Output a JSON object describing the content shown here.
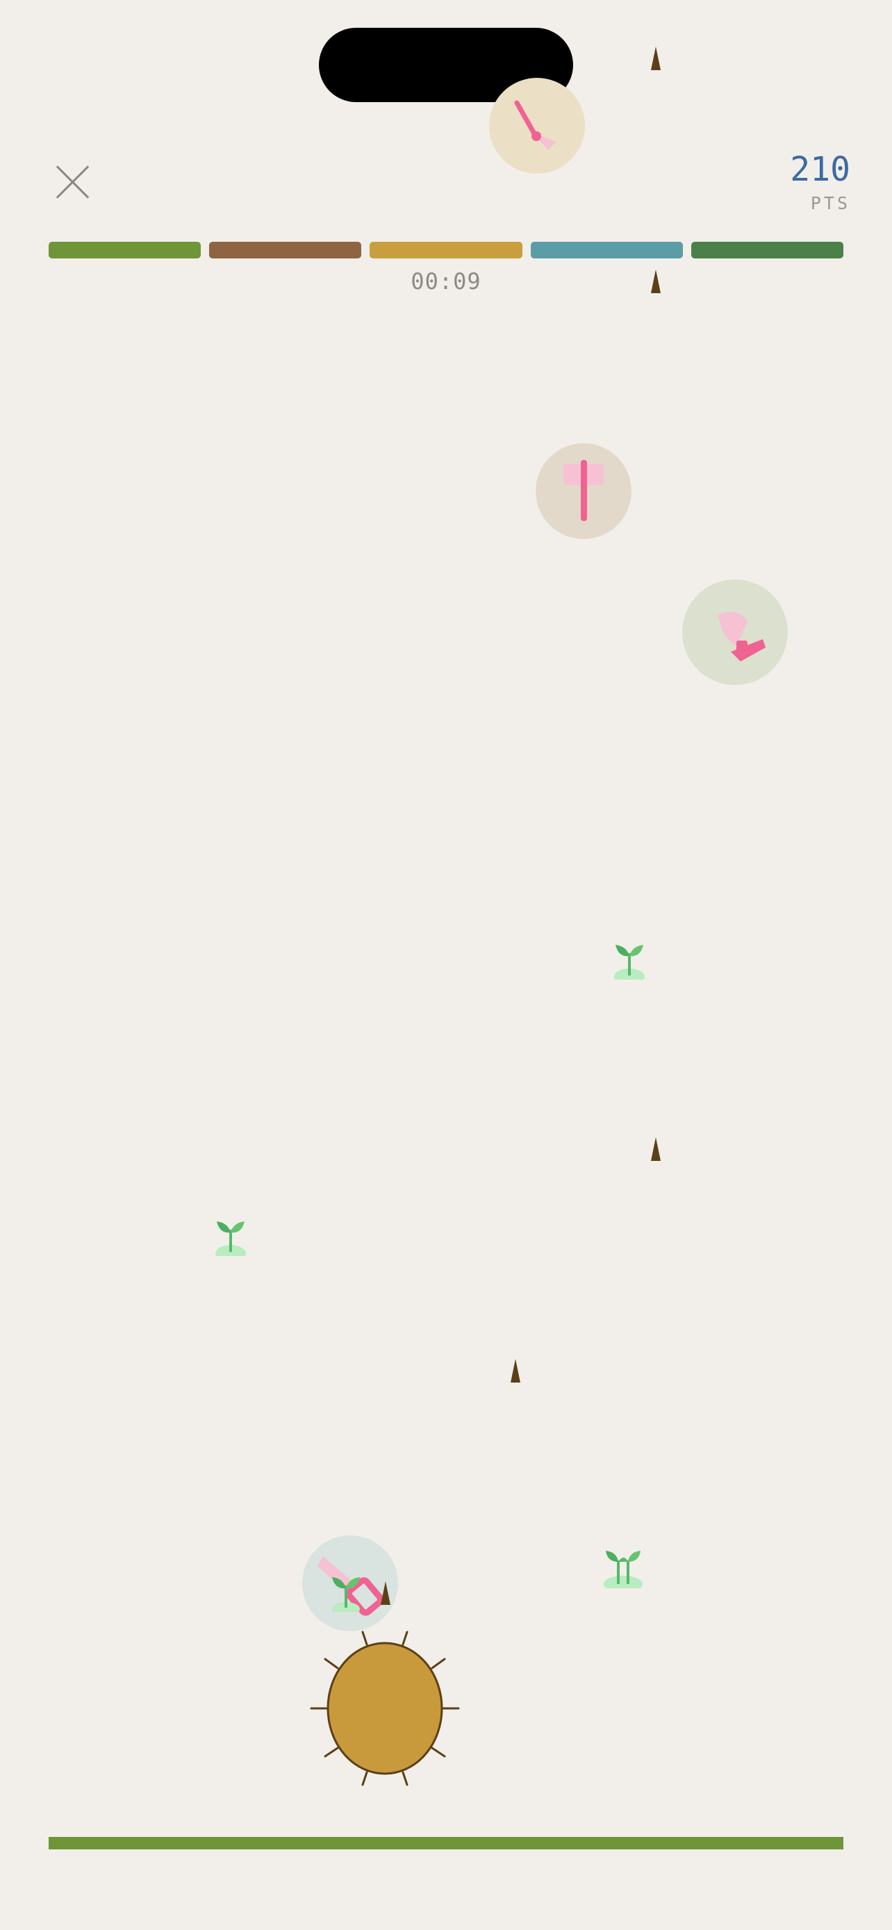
{
  "hud": {
    "close_icon": "close-icon",
    "score_value": "210",
    "score_unit": "PTS",
    "timer": "00:09",
    "level_segments": [
      {
        "color": "#6f9539"
      },
      {
        "color": "#8e6540"
      },
      {
        "color": "#c99e3f"
      },
      {
        "color": "#5b9da6"
      },
      {
        "color": "#4a8148"
      }
    ]
  },
  "colors": {
    "background": "#f2efea",
    "accent_pink": "#f06292",
    "thorn": "#5b4017",
    "player": "#c99a3c",
    "ground": "#6f9539"
  },
  "scene": {
    "tools": [
      "pin-tool-icon",
      "hammer-tool-icon",
      "axe-tool-icon",
      "saw-tool-icon"
    ],
    "sprout_icon": "sprout-icon",
    "thorn_icon": "thorn-icon",
    "player_icon": "spiky-seed-icon"
  }
}
